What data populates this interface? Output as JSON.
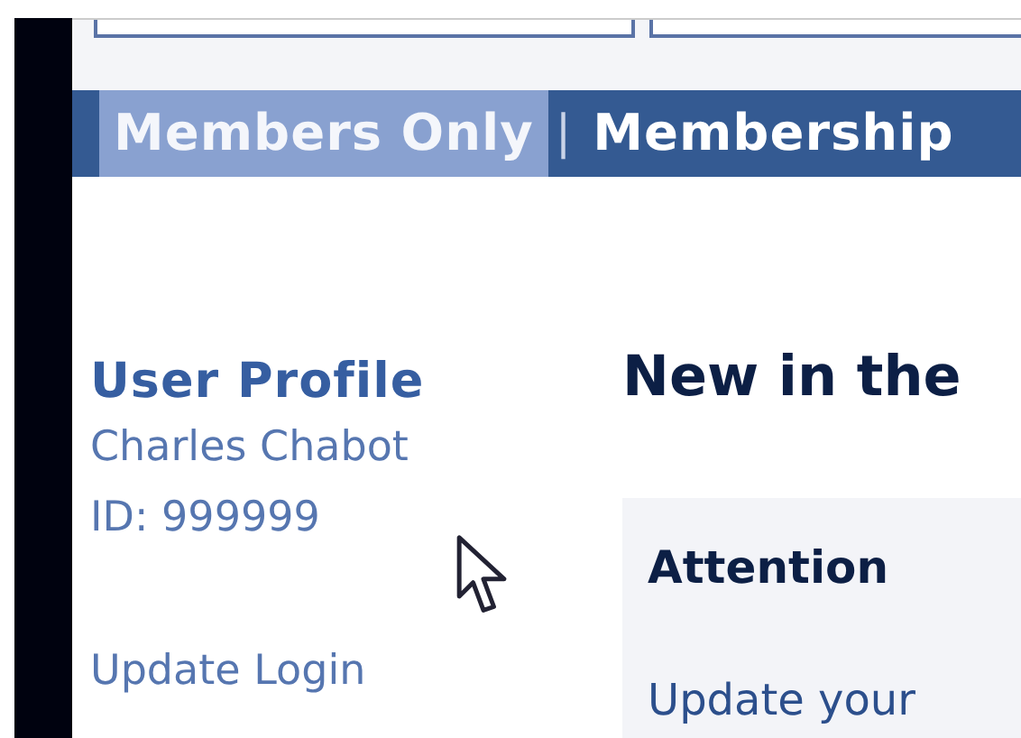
{
  "top_fields": [
    {
      "kind": "field"
    },
    {
      "kind": "field"
    }
  ],
  "nav": {
    "items": [
      {
        "label": "Members Only",
        "selected": true
      },
      {
        "label": "Membership",
        "selected": false
      }
    ],
    "separator": "|"
  },
  "sidebar": {
    "title": "User Profile",
    "lines": [
      "Charles Chabot",
      "ID: 999999"
    ],
    "links": [
      "Update Login"
    ]
  },
  "main": {
    "heading": "New in the",
    "notice": {
      "title": "Attention",
      "text": "Update your"
    }
  }
}
